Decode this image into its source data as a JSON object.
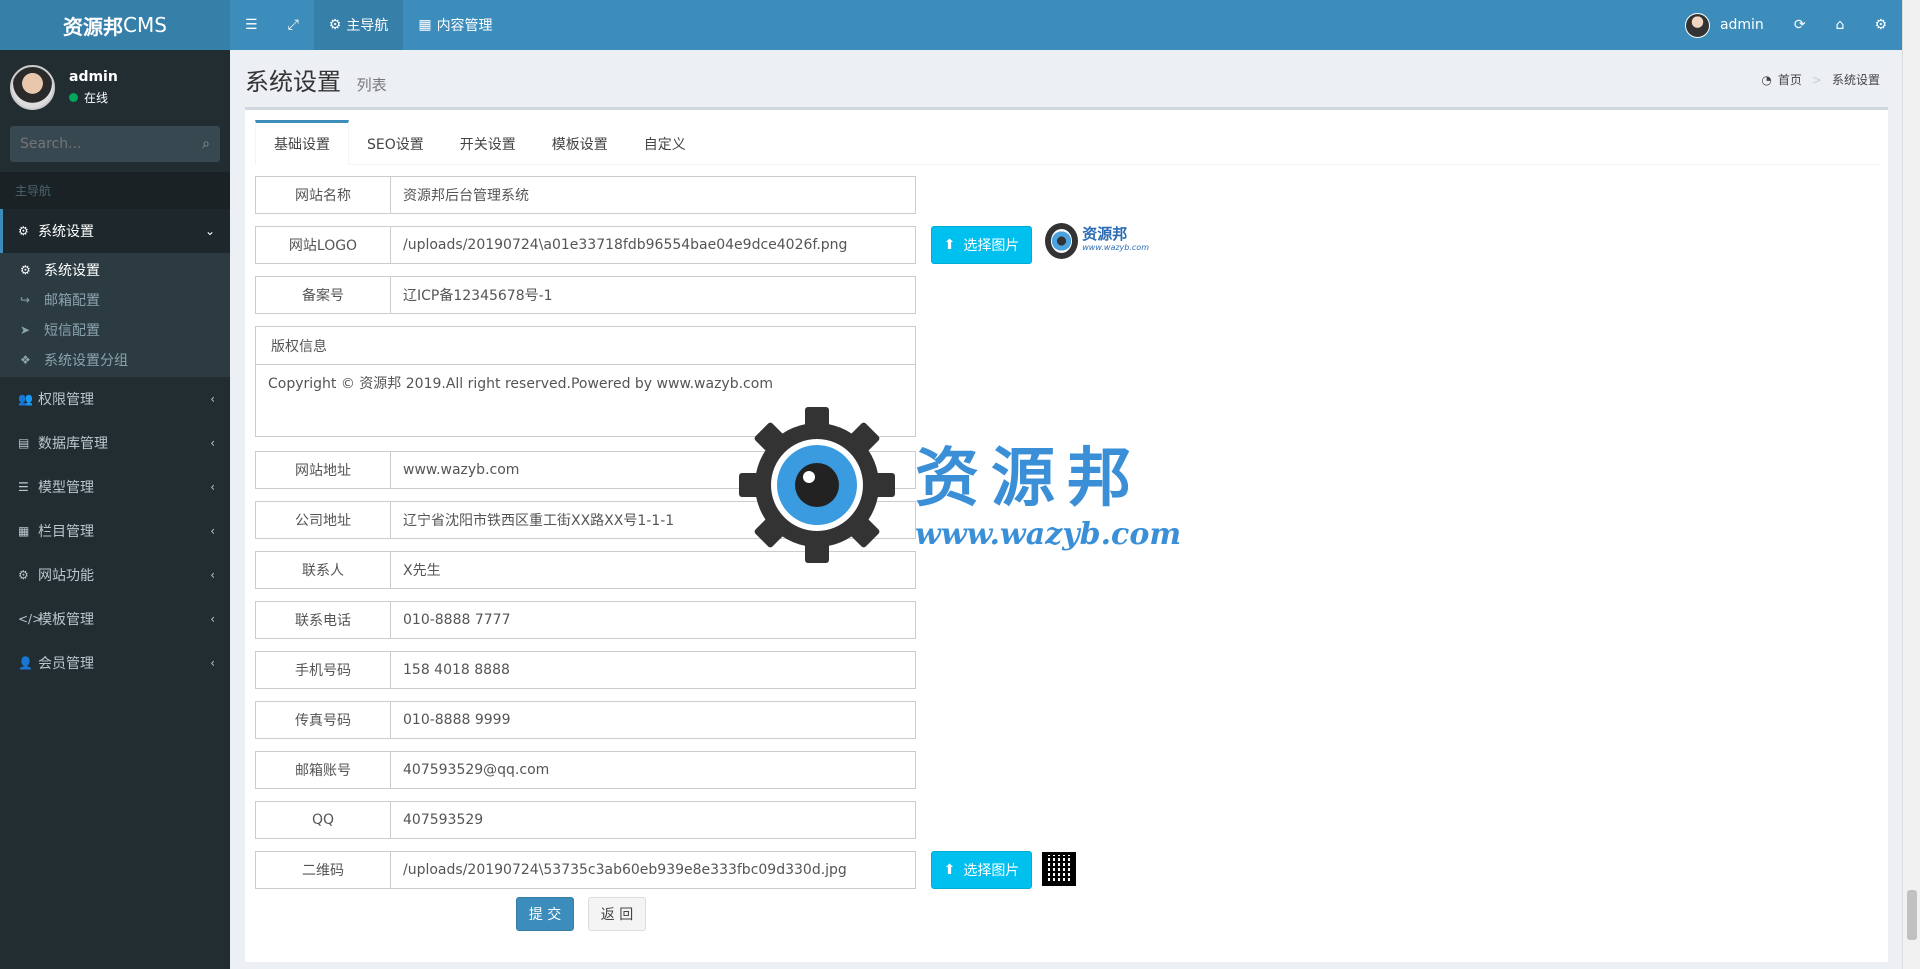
{
  "header": {
    "logo_bold": "资源邦",
    "logo_rest": " CMS",
    "nav": [
      {
        "label": "主导航",
        "icon": "gear-icon"
      },
      {
        "label": "内容管理",
        "icon": "grid-icon"
      }
    ],
    "user": "admin"
  },
  "sidebar": {
    "user_name": "admin",
    "user_status": "在线",
    "search_placeholder": "Search...",
    "section_header": "主导航",
    "active_menu": "系统设置",
    "submenu": [
      {
        "label": "系统设置",
        "icon": "gear-icon"
      },
      {
        "label": "邮箱配置",
        "icon": "share-icon"
      },
      {
        "label": "短信配置",
        "icon": "send-icon"
      },
      {
        "label": "系统设置分组",
        "icon": "cubes-icon"
      }
    ],
    "menu": [
      {
        "label": "权限管理",
        "icon": "users-icon"
      },
      {
        "label": "数据库管理",
        "icon": "database-icon"
      },
      {
        "label": "模型管理",
        "icon": "list-icon"
      },
      {
        "label": "栏目管理",
        "icon": "th-icon"
      },
      {
        "label": "网站功能",
        "icon": "gear-icon"
      },
      {
        "label": "模板管理",
        "icon": "code-icon"
      },
      {
        "label": "会员管理",
        "icon": "user-icon"
      }
    ]
  },
  "page": {
    "title": "系统设置",
    "subtitle": "列表",
    "breadcrumb_home": "首页",
    "breadcrumb_current": "系统设置"
  },
  "tabs": [
    "基础设置",
    "SEO设置",
    "开关设置",
    "模板设置",
    "自定义"
  ],
  "form": {
    "site_name": {
      "label": "网站名称",
      "value": "资源邦后台管理系统"
    },
    "site_logo": {
      "label": "网站LOGO",
      "value": "/uploads/20190724\\a01e33718fdb96554bae04e9dce4026f.png"
    },
    "icp": {
      "label": "备案号",
      "value": "辽ICP备12345678号-1"
    },
    "copyright": {
      "label": "版权信息",
      "value": "Copyright © 资源邦 2019.All right reserved.Powered by www.wazyb.com"
    },
    "site_url": {
      "label": "网站地址",
      "value": "www.wazyb.com"
    },
    "address": {
      "label": "公司地址",
      "value": "辽宁省沈阳市铁西区重工街XX路XX号1-1-1"
    },
    "contact": {
      "label": "联系人",
      "value": "X先生"
    },
    "phone": {
      "label": "联系电话",
      "value": "010-8888 7777"
    },
    "mobile": {
      "label": "手机号码",
      "value": "158 4018 8888"
    },
    "fax": {
      "label": "传真号码",
      "value": "010-8888 9999"
    },
    "email": {
      "label": "邮箱账号",
      "value": "407593529@qq.com"
    },
    "qq": {
      "label": "QQ",
      "value": "407593529"
    },
    "qrcode": {
      "label": "二维码",
      "value": "/uploads/20190724\\53735c3ab60eb939e8e333fbc09d330d.jpg"
    },
    "upload_label": "选择图片",
    "submit_label": "提 交",
    "back_label": "返 回"
  },
  "watermark": {
    "title": "资源邦",
    "url": "www.wazyb.com"
  },
  "logo_preview": {
    "title": "资源邦",
    "url": "www.wazyb.com"
  }
}
